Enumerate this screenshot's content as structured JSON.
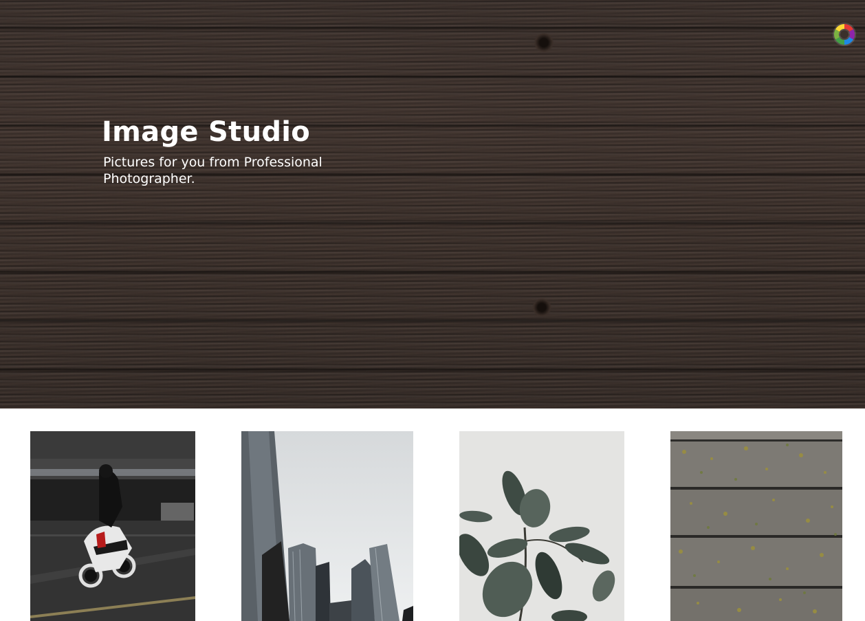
{
  "hero": {
    "title": "Image Studio",
    "subtitle": "Pictures for you from Professional Photographer."
  },
  "logo": {
    "icon": "color-wheel-icon",
    "colors": [
      "#e53935",
      "#fdd835",
      "#43a047",
      "#1e88e5",
      "#8e24aa"
    ]
  },
  "gallery": {
    "photos": [
      {
        "subject": "motorcycle-photo"
      },
      {
        "subject": "skyscrapers-photo"
      },
      {
        "subject": "plant-leaves-photo"
      },
      {
        "subject": "mossy-wood-planks-photo"
      }
    ]
  }
}
